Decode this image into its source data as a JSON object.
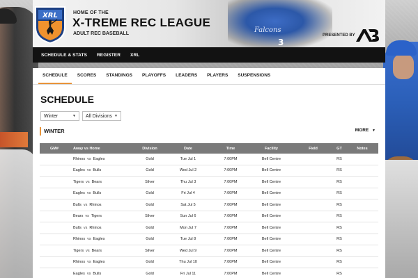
{
  "header": {
    "pre_title": "HOME OF THE",
    "title": "X-TREME REC LEAGUE",
    "subtitle": "ADULT REC BASEBALL",
    "logo_text": "XRL",
    "presented_by": "PRESENTED BY",
    "sponsor_text": "AB",
    "jersey_text": "Falcons",
    "jersey_number": "3"
  },
  "main_nav": {
    "items": [
      {
        "label": "SCHEDULE & STATS"
      },
      {
        "label": "REGISTER"
      },
      {
        "label": "XRL"
      }
    ]
  },
  "sub_nav": {
    "tabs": [
      {
        "label": "SCHEDULE",
        "active": true
      },
      {
        "label": "SCORES"
      },
      {
        "label": "STANDINGS"
      },
      {
        "label": "PLAYOFFS"
      },
      {
        "label": "LEADERS"
      },
      {
        "label": "PLAYERS"
      },
      {
        "label": "SUSPENSIONS"
      }
    ]
  },
  "page": {
    "title": "SCHEDULE",
    "season_filter": "Winter",
    "division_filter": "All Divisions",
    "section_title": "WINTER",
    "more_label": "MORE"
  },
  "table": {
    "headers": {
      "gm": "GM#",
      "match": "Away vs Home",
      "division": "Division",
      "date": "Date",
      "time": "Time",
      "facility": "Facility",
      "field": "Field",
      "gt": "GT",
      "notes": "Notes"
    },
    "vs": "vs",
    "rows": [
      {
        "gm": "",
        "away": "Rhinos",
        "home": "Eagles",
        "division": "Gold",
        "date": "Tue Jul 1",
        "time": "7:00PM",
        "facility": "Bell Centre",
        "field": "",
        "gt": "RS",
        "notes": ""
      },
      {
        "gm": "",
        "away": "Eagles",
        "home": "Bulls",
        "division": "Gold",
        "date": "Wed Jul 2",
        "time": "7:00PM",
        "facility": "Bell Centre",
        "field": "",
        "gt": "RS",
        "notes": ""
      },
      {
        "gm": "",
        "away": "Tigers",
        "home": "Bears",
        "division": "Silver",
        "date": "Thu Jul 3",
        "time": "7:00PM",
        "facility": "Bell Centre",
        "field": "",
        "gt": "RS",
        "notes": ""
      },
      {
        "gm": "",
        "away": "Eagles",
        "home": "Bulls",
        "division": "Gold",
        "date": "Fri Jul 4",
        "time": "7:00PM",
        "facility": "Bell Centre",
        "field": "",
        "gt": "RS",
        "notes": ""
      },
      {
        "gm": "",
        "away": "Bulls",
        "home": "Rhinos",
        "division": "Gold",
        "date": "Sat Jul 5",
        "time": "7:00PM",
        "facility": "Bell Centre",
        "field": "",
        "gt": "RS",
        "notes": ""
      },
      {
        "gm": "",
        "away": "Bears",
        "home": "Tigers",
        "division": "Silver",
        "date": "Sun Jul 6",
        "time": "7:00PM",
        "facility": "Bell Centre",
        "field": "",
        "gt": "RS",
        "notes": ""
      },
      {
        "gm": "",
        "away": "Bulls",
        "home": "Rhinos",
        "division": "Gold",
        "date": "Mon Jul 7",
        "time": "7:00PM",
        "facility": "Bell Centre",
        "field": "",
        "gt": "RS",
        "notes": ""
      },
      {
        "gm": "",
        "away": "Rhinos",
        "home": "Eagles",
        "division": "Gold",
        "date": "Tue Jul 8",
        "time": "7:00PM",
        "facility": "Bell Centre",
        "field": "",
        "gt": "RS",
        "notes": ""
      },
      {
        "gm": "",
        "away": "Tigers",
        "home": "Bears",
        "division": "Silver",
        "date": "Wed Jul 9",
        "time": "7:00PM",
        "facility": "Bell Centre",
        "field": "",
        "gt": "RS",
        "notes": ""
      },
      {
        "gm": "",
        "away": "Rhinos",
        "home": "Eagles",
        "division": "Gold",
        "date": "Thu Jul 10",
        "time": "7:00PM",
        "facility": "Bell Centre",
        "field": "",
        "gt": "RS",
        "notes": ""
      },
      {
        "gm": "",
        "away": "Eagles",
        "home": "Bulls",
        "division": "Gold",
        "date": "Fri Jul 11",
        "time": "7:00PM",
        "facility": "Bell Centre",
        "field": "",
        "gt": "RS",
        "notes": ""
      }
    ]
  },
  "colors": {
    "accent": "#e8943a",
    "nav_bg": "#121212",
    "table_header_bg": "#7a7a7a",
    "logo_blue": "#3b6fc7",
    "logo_orange": "#f0922e"
  },
  "icons": {
    "dropdown": "caret-down-icon",
    "logo": "xrl-shield-logo",
    "sponsor": "ab-sponsor-logo"
  }
}
